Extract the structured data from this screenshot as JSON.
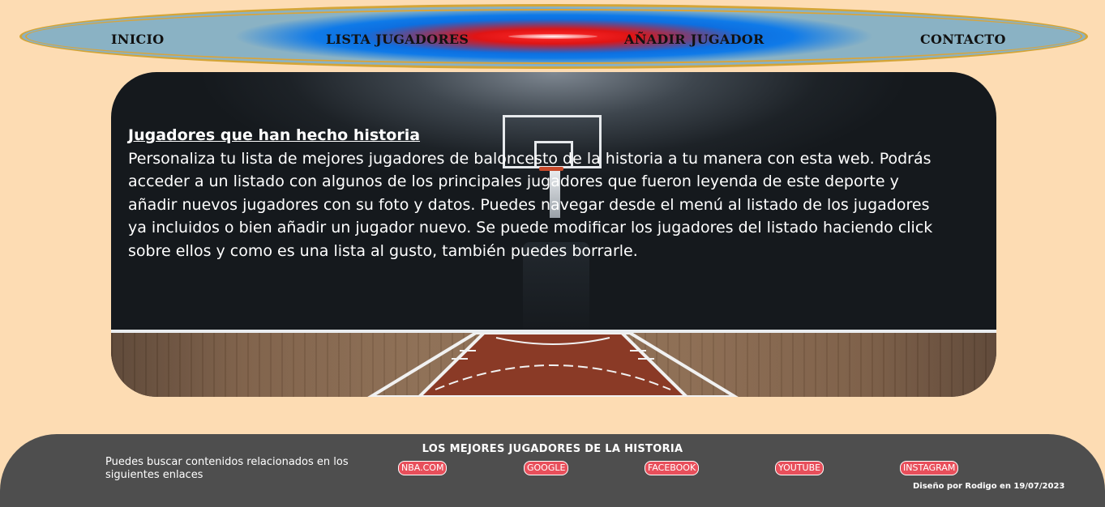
{
  "nav": {
    "items": [
      {
        "label": "INICIO"
      },
      {
        "label": "LISTA JUGADORES"
      },
      {
        "label": "AÑADIR JUGADOR"
      },
      {
        "label": "CONTACTO"
      }
    ]
  },
  "hero": {
    "title": "Jugadores que han hecho historia",
    "body": "Personaliza tu lista de mejores jugadores de baloncesto de la historia a tu manera con esta web. Podrás acceder a un listado con algunos de los principales jugadores que fueron leyenda de este deporte y añadir nuevos jugadores con su foto y datos. Puedes navegar desde el menú al listado de los jugadores ya incluidos o bien añadir un jugador nuevo. Se puede modificar los jugadores del listado haciendo click sobre ellos y como es una lista al gusto, también puedes borrarle."
  },
  "footer": {
    "title": "LOS MEJORES JUGADORES DE LA HISTORIA",
    "note": "Puedes buscar contenidos relacionados en los siguientes enlaces",
    "links": [
      {
        "label": "NBA.COM"
      },
      {
        "label": "GOOGLE"
      },
      {
        "label": "FACEBOOK"
      },
      {
        "label": "YOUTUBE"
      },
      {
        "label": "INSTAGRAM"
      }
    ],
    "credit": "Diseño por Rodigo en 19/07/2023"
  },
  "colors": {
    "page_background": "#fddcb3",
    "nav_border": "#d4a537",
    "nav_blue": "#0d6fe0",
    "nav_red": "#e01414",
    "footer_background": "#4e4e4e",
    "link_background": "#e84f5b"
  }
}
